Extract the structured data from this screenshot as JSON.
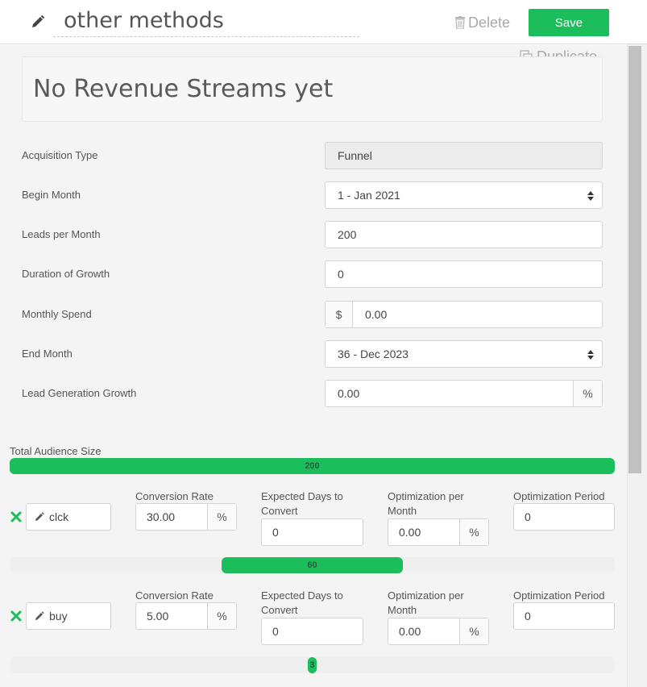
{
  "header": {
    "title": "other methods",
    "delete_label": "Delete",
    "save_label": "Save",
    "accent_color": "#1bbe5b"
  },
  "main": {
    "duplicate_label": "Duplicate",
    "revenue_placeholder": "No Revenue Streams yet",
    "fields": {
      "acquisition_type": {
        "label": "Acquisition Type",
        "value": "Funnel"
      },
      "begin_month": {
        "label": "Begin Month",
        "value": "1 - Jan 2021"
      },
      "leads_per_month": {
        "label": "Leads per Month",
        "value": "200"
      },
      "duration_of_growth": {
        "label": "Duration of Growth",
        "value": "0"
      },
      "monthly_spend": {
        "label": "Monthly Spend",
        "prefix": "$",
        "value": "0.00"
      },
      "end_month": {
        "label": "End Month",
        "value": "36 - Dec 2023"
      },
      "lead_generation_growth": {
        "label": "Lead Generation Growth",
        "value": "0.00",
        "suffix": "%"
      }
    },
    "audience": {
      "label": "Total Audience Size",
      "value": "200",
      "fraction": 1.0
    },
    "steps": [
      {
        "name": "clck",
        "conversion_rate_label": "Conversion Rate",
        "conversion_rate": "30.00",
        "conversion_rate_suffix": "%",
        "days_label_1": "Expected Days to",
        "days_label_2": "Convert",
        "days_value": "0",
        "opt_label_1": "Optimization per",
        "opt_label_2": "Month",
        "opt_value": "0.00",
        "opt_suffix": "%",
        "period_label": "Optimization Period",
        "period_value": "0",
        "result_value": "60",
        "result_fraction": 0.3
      },
      {
        "name": "buy",
        "conversion_rate_label": "Conversion Rate",
        "conversion_rate": "5.00",
        "conversion_rate_suffix": "%",
        "days_label_1": "Expected Days to",
        "days_label_2": "Convert",
        "days_value": "0",
        "opt_label_1": "Optimization per",
        "opt_label_2": "Month",
        "opt_value": "0.00",
        "opt_suffix": "%",
        "period_label": "Optimization Period",
        "period_value": "0",
        "result_value": "3",
        "result_fraction": 0.015
      }
    ]
  }
}
